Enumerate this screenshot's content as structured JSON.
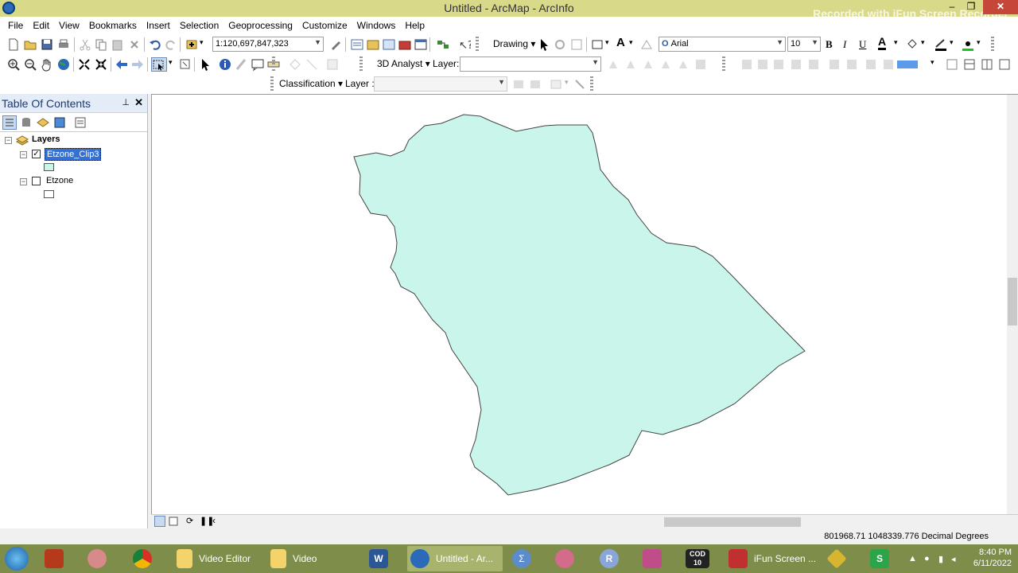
{
  "window": {
    "title": "Untitled - ArcMap - ArcInfo",
    "watermark": "Recorded with iFun Screen Recorder",
    "controls": {
      "minimize": "–",
      "maximize": "❐",
      "close": "✕"
    }
  },
  "menubar": [
    "File",
    "Edit",
    "View",
    "Bookmarks",
    "Insert",
    "Selection",
    "Geoprocessing",
    "Customize",
    "Windows",
    "Help"
  ],
  "toolbar": {
    "scale_value": "1:120,697,847,323",
    "drawing_label": "Drawing",
    "font_name": "Arial",
    "font_size": "10",
    "bold": "B",
    "italic": "I",
    "underline": "U",
    "font_color_letter": "A",
    "analyst_label": "3D Analyst",
    "layer_label": "Layer:",
    "classification_label": "Classification",
    "layer_label2": "Layer :"
  },
  "toc": {
    "title": "Table Of Contents",
    "pin": "⊥",
    "close": "✕",
    "root_label": "Layers",
    "layers": [
      {
        "name": "Etzone_Clip3",
        "checked": true,
        "fill": "#c9f5ea"
      },
      {
        "name": "Etzone",
        "checked": false,
        "fill": "#ffffff"
      }
    ]
  },
  "map": {
    "polygon_fill": "#c9f5ea",
    "polygon_stroke": "#444444"
  },
  "statusbar": {
    "coordinates": "801968.71  1048339.776 Decimal Degrees"
  },
  "taskbar": {
    "apps": [
      {
        "name": "start-button",
        "label": "",
        "icon": "windows-start-icon",
        "color": "#1c7fcf"
      },
      {
        "name": "taskbar-app-1",
        "label": "",
        "icon": "app-icon",
        "color": "#b53a1c"
      },
      {
        "name": "taskbar-app-2",
        "label": "",
        "icon": "app-icon",
        "color": "#d88a8a"
      },
      {
        "name": "taskbar-chrome",
        "label": "",
        "icon": "chrome-icon",
        "color": "#e0b832"
      },
      {
        "name": "taskbar-video-editor",
        "label": "Video Editor",
        "icon": "folder-icon",
        "color": "#f3d36a"
      },
      {
        "name": "taskbar-video",
        "label": "Video",
        "icon": "folder-icon",
        "color": "#f3d36a"
      },
      {
        "name": "taskbar-word",
        "label": "",
        "icon": "word-icon",
        "color": "#2b5797"
      },
      {
        "name": "taskbar-arcmap",
        "label": "Untitled - Ar...",
        "icon": "arcmap-icon",
        "color": "#2a6ab8"
      },
      {
        "name": "taskbar-sigma",
        "label": "",
        "icon": "sigma-icon",
        "color": "#5c8ccc"
      },
      {
        "name": "taskbar-app-10",
        "label": "",
        "icon": "globe-icon",
        "color": "#d36b8a"
      },
      {
        "name": "taskbar-r",
        "label": "R",
        "icon": "r-icon",
        "color": "#8aa6d8"
      },
      {
        "name": "taskbar-camera",
        "label": "",
        "icon": "camera-icon",
        "color": "#c04c8a"
      },
      {
        "name": "taskbar-cod",
        "label": "COD 10",
        "icon": "game-icon",
        "color": "#222222"
      },
      {
        "name": "taskbar-ifun",
        "label": "iFun Screen ...",
        "icon": "recorder-icon",
        "color": "#c03030"
      },
      {
        "name": "taskbar-app-15",
        "label": "",
        "icon": "diamond-icon",
        "color": "#d8b530"
      },
      {
        "name": "taskbar-s",
        "label": "S",
        "icon": "s-icon",
        "color": "#2ba44a"
      }
    ],
    "time": "8:40 PM",
    "date": "6/11/2022"
  }
}
